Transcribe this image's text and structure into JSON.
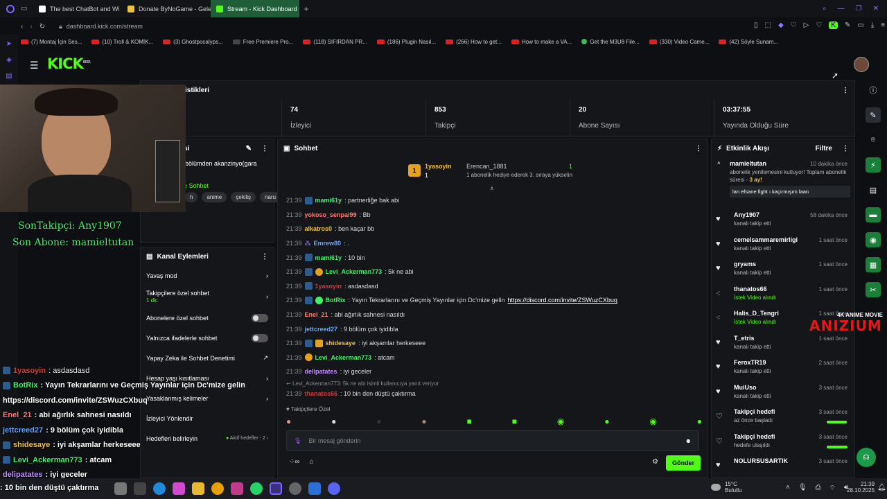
{
  "browser": {
    "tabs": [
      {
        "label": "The best ChatBot and Wi",
        "color": "#ffffff"
      },
      {
        "label": "Donate ByNoGame - Gele",
        "color": "#f0c040"
      },
      {
        "label": "Stream - Kick Dashboard",
        "color": "#53fc18",
        "active": true
      }
    ],
    "url": "dashboard.kick.com/stream",
    "bookmarks": [
      "(7) Montaj İçin Ses...",
      "(10) Troll & KOMİK...",
      "(3) Ghostpocalyps...",
      "Free Premiere Pro...",
      "(118) SIFIRDAN PR...",
      "(186) Plugin Nasıl...",
      "(266) How to get...",
      "How to make a VA...",
      "Get the M3U8 File...",
      "(330) Video Came...",
      "(42) Söyle Sunam..."
    ]
  },
  "header": {
    "logo": "KICK",
    "logo_sup": "BETA"
  },
  "stats": {
    "title": "istikleri",
    "items": [
      {
        "value": "74",
        "label": "İzleyici"
      },
      {
        "value": "853",
        "label": "Takipçi"
      },
      {
        "value": "20",
        "label": "Abone Sayısı"
      },
      {
        "value": "03:37:55",
        "label": "Yayında Olduğu Süre"
      }
    ]
  },
  "stream_info": {
    "title_partial": "si",
    "desc_partial": "bölümden akanzinyo(gara",
    "link_partial": "e Sohbet",
    "tags": [
      "h",
      "anime",
      "çekiliş",
      "naru"
    ]
  },
  "overlay": {
    "last_follower": "SonTakipçi: Any1907",
    "last_sub": "Son Abone: mamieltutan",
    "chat": [
      {
        "user": "1yasoyin",
        "text": ": asdasdasd",
        "color": "#d33a3a"
      },
      {
        "user": "BotRix",
        "text": ": Yayın Tekrarlarını ve Geçmiş Yayınlar için Dc'mize gelin",
        "color": "#44f06a"
      },
      {
        "user": "",
        "text": "https://discord.com/invite/ZSWuzCXbuq",
        "color": "#ffffff"
      },
      {
        "user": "Enel_21",
        "text": ": abi ağırlık sahnesi nasıldı",
        "color": "#ff7b7b"
      },
      {
        "user": "jettcreed27",
        "text": ": 9 bölüm çok iyidibla",
        "color": "#63a6ff"
      },
      {
        "user": "shidesaye",
        "text": ": iyi akşamlar herkeseee",
        "color": "#f0c040"
      },
      {
        "user": "Levi_Ackerman773",
        "text": ": atcam",
        "color": "#44f06a"
      },
      {
        "user": "delipatates",
        "text": ": iyi geceler",
        "color": "#c28cff"
      },
      {
        "user": "",
        "text": ": 10 bin den düştü çaktırma",
        "color": "#ffffff"
      }
    ],
    "brand": "ANIZIUM",
    "brand_sub": "4K ANIME MOVIE"
  },
  "channel_actions": {
    "title": "Kanal Eylemleri",
    "items": [
      {
        "label": "Yavaş mod",
        "kind": "arrow"
      },
      {
        "label": "Takipçilere özel sohbet",
        "sub": "1 dk.",
        "kind": "arrow"
      },
      {
        "label": "Abonelere özel sohbet",
        "kind": "toggle"
      },
      {
        "label": "Yalnızca ifadelerle sohbet",
        "kind": "toggle"
      },
      {
        "label": "Yapay Zeka ile Sohbet Denetimi",
        "kind": "ext"
      },
      {
        "label": "Hesap yaşı kısıtlaması",
        "kind": "arrow"
      },
      {
        "label": "Yasaklanmış kelimeler",
        "kind": "arrow"
      },
      {
        "label": "İzleyici Yönlendir",
        "kind": "none"
      },
      {
        "label": "Hedefleri belirleyin",
        "sub2": "Aktif hedefler - 2",
        "kind": "arrow"
      }
    ]
  },
  "chat": {
    "title": "Sohbet",
    "pinned": {
      "user": "1yasoyin",
      "count": "1",
      "gifter": "Erencan_1881",
      "gift_count": "1",
      "gift_text": "1 abonelik hediye ederek 3. sıraya yükselin"
    },
    "messages": [
      {
        "time": "21:39",
        "user": "mami61y",
        "text": ": partnerliğe bak abi",
        "color": "#44f06a"
      },
      {
        "time": "21:39",
        "user": "yokoso_senpai99",
        "text": ": Bb",
        "color": "#ff7b7b"
      },
      {
        "time": "21:39",
        "user": "alkatros0",
        "text": ": ben kaçar bb",
        "color": "#f0c040"
      },
      {
        "time": "21:39",
        "user": "Emrew80",
        "text": ": .",
        "color": "#63a6ff"
      },
      {
        "time": "21:39",
        "user": "mami61y",
        "text": ": 10 bin",
        "color": "#44f06a"
      },
      {
        "time": "21:39",
        "user": "Levi_Ackerman773",
        "text": ": 5k ne abi",
        "color": "#44f06a"
      },
      {
        "time": "21:39",
        "user": "1yasoyin",
        "text": ": asdasdasd",
        "color": "#d33a3a"
      },
      {
        "time": "21:39",
        "user": "BotRix",
        "text": ": Yayın Tekrarlarını ve Geçmiş Yayınlar için Dc'mize gelin ",
        "link": "https://discord.com/invite/ZSWuzCXbuq",
        "color": "#44f06a"
      },
      {
        "time": "21:39",
        "user": "Enel_21",
        "text": ": abi ağırlık sahnesi nasıldı",
        "color": "#ff7b7b"
      },
      {
        "time": "21:39",
        "user": "jettcreed27",
        "text": ": 9 bölüm çok iyidibla",
        "color": "#63a6ff"
      },
      {
        "time": "21:39",
        "user": "shidesaye",
        "text": ": iyi akşamlar herkeseee",
        "color": "#f0c040"
      },
      {
        "time": "21:39",
        "user": "Levi_Ackerman773",
        "text": ": atcam",
        "color": "#44f06a"
      },
      {
        "time": "21:39",
        "user": "delipatates",
        "text": ": iyi geceler",
        "color": "#c28cff"
      }
    ],
    "reply_to": "Levi_Ackerman773: 5k ne abi isimli kullanıcıya yanıt veriyor",
    "last": {
      "time": "21:39",
      "user": "thanatos66",
      "text": ": 10 bin den düştü çaktırma",
      "color": "#d33a3a"
    },
    "followers_only": "Takipçilere Özel",
    "input_placeholder": "Bir mesaj gönderin",
    "send": "Gönder"
  },
  "activity": {
    "title": "Etkinlik Akışı",
    "filter": "Filtre",
    "first": {
      "user": "mamieltutan",
      "time": "10 dakika önce",
      "text": "abonelik yenilemesini kutluyor! Toplam abonelik süresi - ",
      "months": "3 ay!",
      "msg": "lan efsane fight ı kaçırmışım laan"
    },
    "items": [
      {
        "user": "Any1907",
        "sub": "kanalı takip etti",
        "time": "58 dakika önce",
        "icon": "heart"
      },
      {
        "user": "cemelsammaremirligi",
        "sub": "kanalı takip etti",
        "time": "1 saat önce",
        "icon": "heart"
      },
      {
        "user": "gryams",
        "sub": "kanalı takip etti",
        "time": "1 saat önce",
        "icon": "heart"
      },
      {
        "user": "thanatos66",
        "sub": "İstek Video alındı",
        "time": "1 saat önce",
        "icon": "dots"
      },
      {
        "user": "Halis_D_Tengri",
        "sub": "İstek Video alındı",
        "time": "1 saat önce",
        "icon": "dots"
      },
      {
        "user": "T_etris",
        "sub": "kanalı takip etti",
        "time": "1 saat önce",
        "icon": "heart"
      },
      {
        "user": "FeroxTR19",
        "sub": "kanalı takip etti",
        "time": "2 saat önce",
        "icon": "heart"
      },
      {
        "user": "MuiUso",
        "sub": "kanalı takip etti",
        "time": "3 saat önce",
        "icon": "heart"
      },
      {
        "user": "Takipçi hedefi",
        "sub": "az önce başladı",
        "time": "3 saat önce",
        "icon": "heart-outline",
        "bar": 0.95
      },
      {
        "user": "Takipçi hedefi",
        "sub": "hedefe ulaşıldı",
        "time": "3 saat önce",
        "icon": "heart-outline",
        "bar": 1.0
      },
      {
        "user": "NOLURSUSARTIK",
        "sub": "",
        "time": "3 saat önce",
        "icon": "heart"
      }
    ]
  },
  "taskbar": {
    "weather": "15°C",
    "weather_sub": "Bulutlu",
    "time": "21:39",
    "date": "28.10.2025"
  },
  "colors": {
    "accent": "#53fc18",
    "panel": "#14161a",
    "bg": "#0d0f12"
  }
}
